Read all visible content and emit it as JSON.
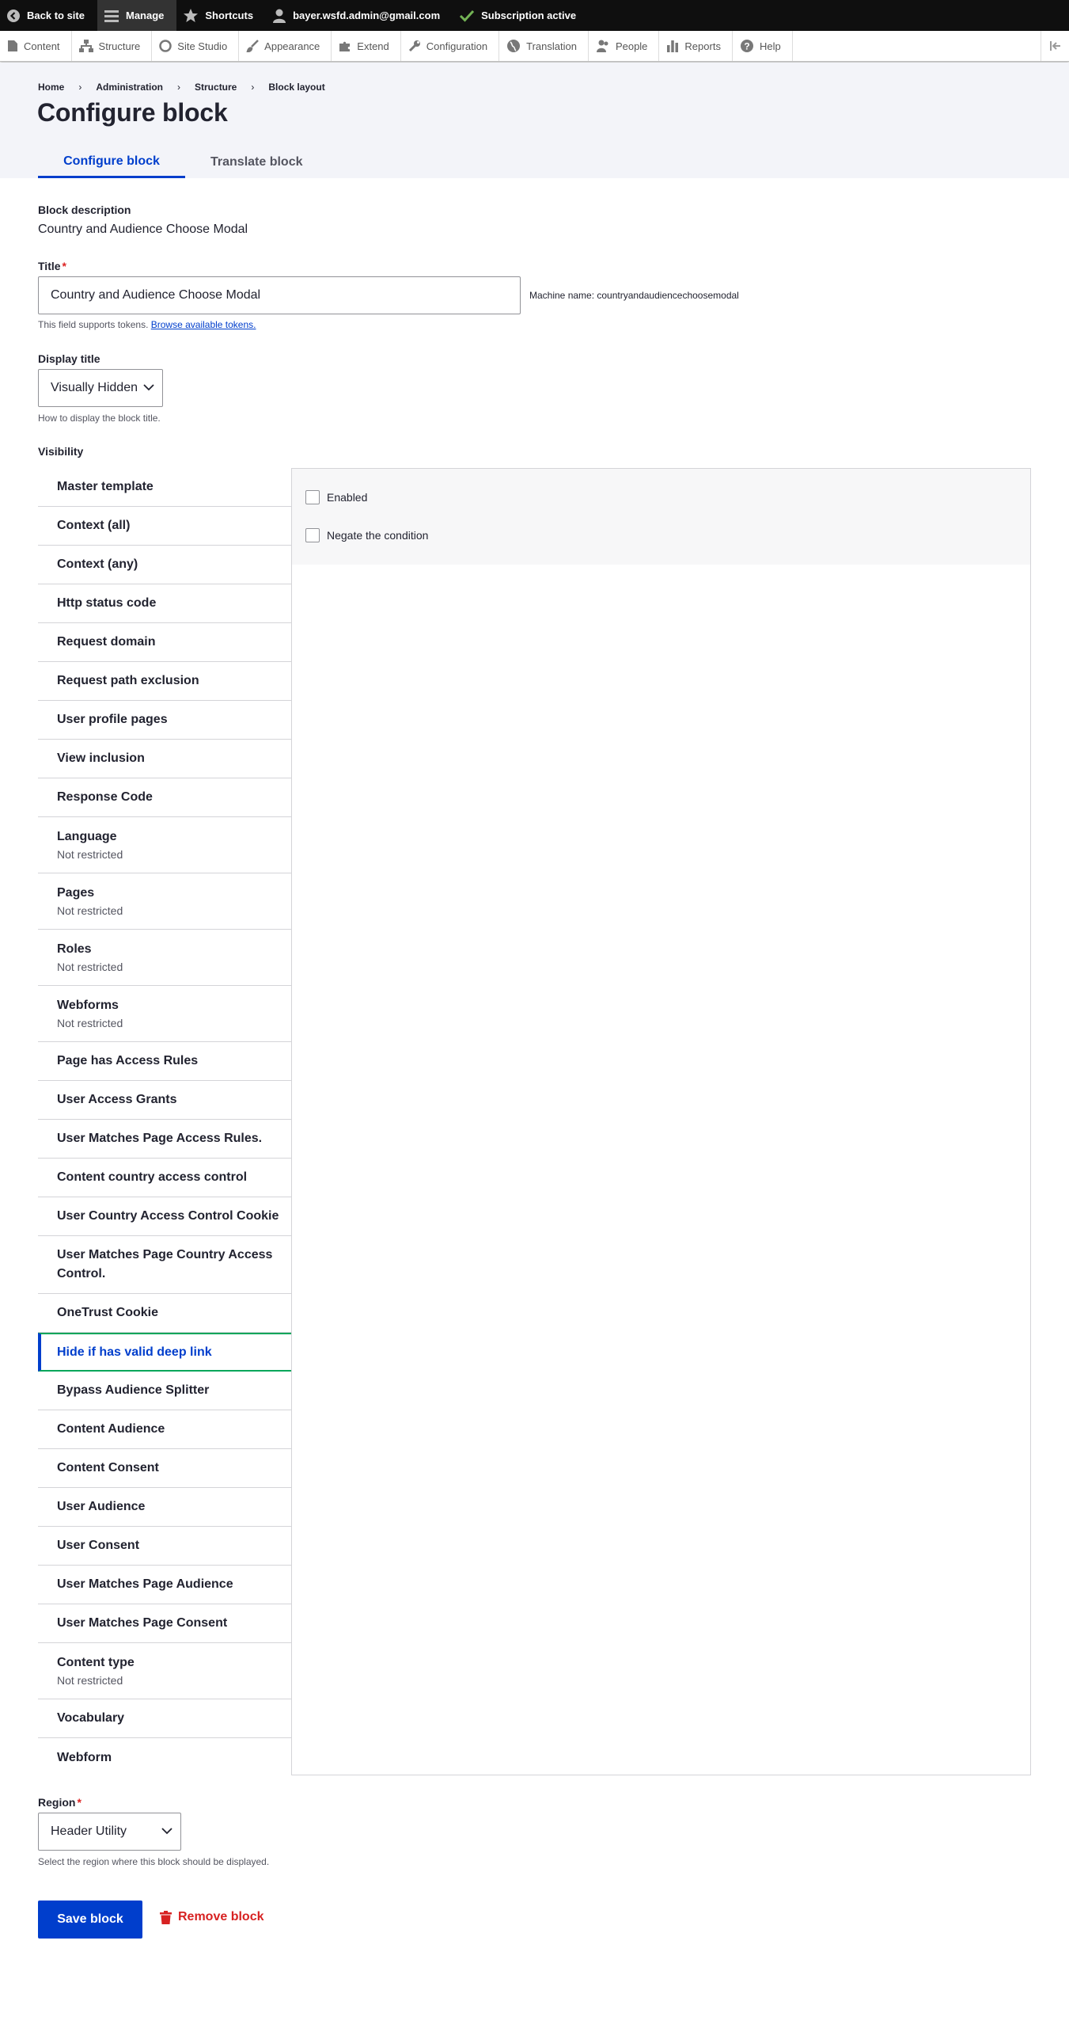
{
  "toolbar": {
    "back_to_site": "Back to site",
    "manage": "Manage",
    "shortcuts": "Shortcuts",
    "user": "bayer.wsfd.admin@gmail.com",
    "subscription": "Subscription active"
  },
  "tray": {
    "items": [
      "Content",
      "Structure",
      "Site Studio",
      "Appearance",
      "Extend",
      "Configuration",
      "Translation",
      "People",
      "Reports",
      "Help"
    ]
  },
  "breadcrumb": [
    "Home",
    "Administration",
    "Structure",
    "Block layout"
  ],
  "page_title": "Configure block",
  "tabs": [
    "Configure block",
    "Translate block"
  ],
  "form": {
    "block_description_label": "Block description",
    "block_description_value": "Country and Audience Choose Modal",
    "title_label": "Title",
    "title_required": "*",
    "title_value": "Country and Audience Choose Modal",
    "machine_name": "Machine name: countryandaudiencechoosemodal",
    "tokens_help": "This field supports tokens.",
    "tokens_link": "Browse available tokens.",
    "display_title_label": "Display title",
    "display_title_value": "Visually Hidden",
    "display_title_help": "How to display the block title.",
    "visibility_label": "Visibility",
    "region_label": "Region",
    "region_required": "*",
    "region_value": "Header Utility",
    "region_help": "Select the region where this block should be displayed."
  },
  "visibility": {
    "tabs": [
      {
        "title": "Master template",
        "summary": ""
      },
      {
        "title": "Context (all)",
        "summary": ""
      },
      {
        "title": "Context (any)",
        "summary": ""
      },
      {
        "title": "Http status code",
        "summary": ""
      },
      {
        "title": "Request domain",
        "summary": ""
      },
      {
        "title": "Request path exclusion",
        "summary": ""
      },
      {
        "title": "User profile pages",
        "summary": ""
      },
      {
        "title": "View inclusion",
        "summary": ""
      },
      {
        "title": "Response Code",
        "summary": ""
      },
      {
        "title": "Language",
        "summary": "Not restricted"
      },
      {
        "title": "Pages",
        "summary": "Not restricted"
      },
      {
        "title": "Roles",
        "summary": "Not restricted"
      },
      {
        "title": "Webforms",
        "summary": "Not restricted"
      },
      {
        "title": "Page has Access Rules",
        "summary": ""
      },
      {
        "title": "User Access Grants",
        "summary": ""
      },
      {
        "title": "User Matches Page Access Rules.",
        "summary": ""
      },
      {
        "title": "Content country access control",
        "summary": ""
      },
      {
        "title": "User Country Access Control Cookie",
        "summary": ""
      },
      {
        "title": "User Matches Page Country Access Control.",
        "summary": ""
      },
      {
        "title": "OneTrust Cookie",
        "summary": ""
      },
      {
        "title": "Hide if has valid deep link",
        "summary": ""
      },
      {
        "title": "Bypass Audience Splitter",
        "summary": ""
      },
      {
        "title": "Content Audience",
        "summary": ""
      },
      {
        "title": "Content Consent",
        "summary": ""
      },
      {
        "title": "User Audience",
        "summary": ""
      },
      {
        "title": "User Consent",
        "summary": ""
      },
      {
        "title": "User Matches Page Audience",
        "summary": ""
      },
      {
        "title": "User Matches Page Consent",
        "summary": ""
      },
      {
        "title": "Content type",
        "summary": "Not restricted"
      },
      {
        "title": "Vocabulary",
        "summary": ""
      },
      {
        "title": "Webform",
        "summary": ""
      }
    ],
    "selected_index": 20,
    "pane": {
      "enabled_label": "Enabled",
      "enabled_checked": false,
      "negate_label": "Negate the condition",
      "negate_checked": false
    }
  },
  "actions": {
    "save": "Save block",
    "remove": "Remove block"
  },
  "colors": {
    "primary": "#003ecc",
    "danger": "#d72222",
    "selected_tab_border": "#00a65a"
  }
}
